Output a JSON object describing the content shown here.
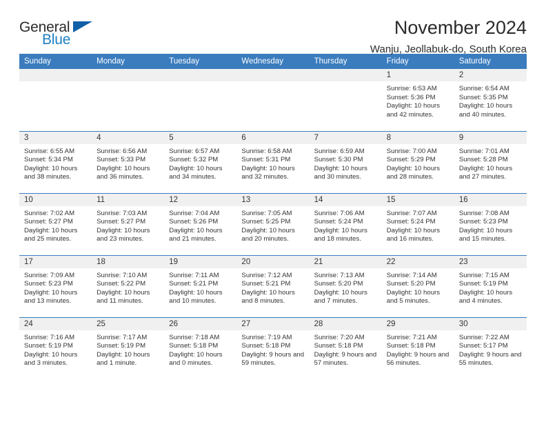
{
  "brand": {
    "name_part1": "General",
    "name_part2": "Blue",
    "flag_color": "#1060a8",
    "blue_color": "#1d7fc3"
  },
  "header": {
    "title": "November 2024",
    "subtitle": "Wanju, Jeollabuk-do, South Korea",
    "header_bar_color": "#3a7cbe"
  },
  "weekday_headers": [
    "Sunday",
    "Monday",
    "Tuesday",
    "Wednesday",
    "Thursday",
    "Friday",
    "Saturday"
  ],
  "labels": {
    "sunrise": "Sunrise:",
    "sunset": "Sunset:",
    "daylight": "Daylight:"
  },
  "weeks": [
    [
      {
        "day": "",
        "sunrise": "",
        "sunset": "",
        "daylight": "",
        "empty": true
      },
      {
        "day": "",
        "sunrise": "",
        "sunset": "",
        "daylight": "",
        "empty": true
      },
      {
        "day": "",
        "sunrise": "",
        "sunset": "",
        "daylight": "",
        "empty": true
      },
      {
        "day": "",
        "sunrise": "",
        "sunset": "",
        "daylight": "",
        "empty": true
      },
      {
        "day": "",
        "sunrise": "",
        "sunset": "",
        "daylight": "",
        "empty": true
      },
      {
        "day": "1",
        "sunrise": "Sunrise: 6:53 AM",
        "sunset": "Sunset: 5:36 PM",
        "daylight": "Daylight: 10 hours and 42 minutes."
      },
      {
        "day": "2",
        "sunrise": "Sunrise: 6:54 AM",
        "sunset": "Sunset: 5:35 PM",
        "daylight": "Daylight: 10 hours and 40 minutes."
      }
    ],
    [
      {
        "day": "3",
        "sunrise": "Sunrise: 6:55 AM",
        "sunset": "Sunset: 5:34 PM",
        "daylight": "Daylight: 10 hours and 38 minutes."
      },
      {
        "day": "4",
        "sunrise": "Sunrise: 6:56 AM",
        "sunset": "Sunset: 5:33 PM",
        "daylight": "Daylight: 10 hours and 36 minutes."
      },
      {
        "day": "5",
        "sunrise": "Sunrise: 6:57 AM",
        "sunset": "Sunset: 5:32 PM",
        "daylight": "Daylight: 10 hours and 34 minutes."
      },
      {
        "day": "6",
        "sunrise": "Sunrise: 6:58 AM",
        "sunset": "Sunset: 5:31 PM",
        "daylight": "Daylight: 10 hours and 32 minutes."
      },
      {
        "day": "7",
        "sunrise": "Sunrise: 6:59 AM",
        "sunset": "Sunset: 5:30 PM",
        "daylight": "Daylight: 10 hours and 30 minutes."
      },
      {
        "day": "8",
        "sunrise": "Sunrise: 7:00 AM",
        "sunset": "Sunset: 5:29 PM",
        "daylight": "Daylight: 10 hours and 28 minutes."
      },
      {
        "day": "9",
        "sunrise": "Sunrise: 7:01 AM",
        "sunset": "Sunset: 5:28 PM",
        "daylight": "Daylight: 10 hours and 27 minutes."
      }
    ],
    [
      {
        "day": "10",
        "sunrise": "Sunrise: 7:02 AM",
        "sunset": "Sunset: 5:27 PM",
        "daylight": "Daylight: 10 hours and 25 minutes."
      },
      {
        "day": "11",
        "sunrise": "Sunrise: 7:03 AM",
        "sunset": "Sunset: 5:27 PM",
        "daylight": "Daylight: 10 hours and 23 minutes."
      },
      {
        "day": "12",
        "sunrise": "Sunrise: 7:04 AM",
        "sunset": "Sunset: 5:26 PM",
        "daylight": "Daylight: 10 hours and 21 minutes."
      },
      {
        "day": "13",
        "sunrise": "Sunrise: 7:05 AM",
        "sunset": "Sunset: 5:25 PM",
        "daylight": "Daylight: 10 hours and 20 minutes."
      },
      {
        "day": "14",
        "sunrise": "Sunrise: 7:06 AM",
        "sunset": "Sunset: 5:24 PM",
        "daylight": "Daylight: 10 hours and 18 minutes."
      },
      {
        "day": "15",
        "sunrise": "Sunrise: 7:07 AM",
        "sunset": "Sunset: 5:24 PM",
        "daylight": "Daylight: 10 hours and 16 minutes."
      },
      {
        "day": "16",
        "sunrise": "Sunrise: 7:08 AM",
        "sunset": "Sunset: 5:23 PM",
        "daylight": "Daylight: 10 hours and 15 minutes."
      }
    ],
    [
      {
        "day": "17",
        "sunrise": "Sunrise: 7:09 AM",
        "sunset": "Sunset: 5:23 PM",
        "daylight": "Daylight: 10 hours and 13 minutes."
      },
      {
        "day": "18",
        "sunrise": "Sunrise: 7:10 AM",
        "sunset": "Sunset: 5:22 PM",
        "daylight": "Daylight: 10 hours and 11 minutes."
      },
      {
        "day": "19",
        "sunrise": "Sunrise: 7:11 AM",
        "sunset": "Sunset: 5:21 PM",
        "daylight": "Daylight: 10 hours and 10 minutes."
      },
      {
        "day": "20",
        "sunrise": "Sunrise: 7:12 AM",
        "sunset": "Sunset: 5:21 PM",
        "daylight": "Daylight: 10 hours and 8 minutes."
      },
      {
        "day": "21",
        "sunrise": "Sunrise: 7:13 AM",
        "sunset": "Sunset: 5:20 PM",
        "daylight": "Daylight: 10 hours and 7 minutes."
      },
      {
        "day": "22",
        "sunrise": "Sunrise: 7:14 AM",
        "sunset": "Sunset: 5:20 PM",
        "daylight": "Daylight: 10 hours and 5 minutes."
      },
      {
        "day": "23",
        "sunrise": "Sunrise: 7:15 AM",
        "sunset": "Sunset: 5:19 PM",
        "daylight": "Daylight: 10 hours and 4 minutes."
      }
    ],
    [
      {
        "day": "24",
        "sunrise": "Sunrise: 7:16 AM",
        "sunset": "Sunset: 5:19 PM",
        "daylight": "Daylight: 10 hours and 3 minutes."
      },
      {
        "day": "25",
        "sunrise": "Sunrise: 7:17 AM",
        "sunset": "Sunset: 5:19 PM",
        "daylight": "Daylight: 10 hours and 1 minute."
      },
      {
        "day": "26",
        "sunrise": "Sunrise: 7:18 AM",
        "sunset": "Sunset: 5:18 PM",
        "daylight": "Daylight: 10 hours and 0 minutes."
      },
      {
        "day": "27",
        "sunrise": "Sunrise: 7:19 AM",
        "sunset": "Sunset: 5:18 PM",
        "daylight": "Daylight: 9 hours and 59 minutes."
      },
      {
        "day": "28",
        "sunrise": "Sunrise: 7:20 AM",
        "sunset": "Sunset: 5:18 PM",
        "daylight": "Daylight: 9 hours and 57 minutes."
      },
      {
        "day": "29",
        "sunrise": "Sunrise: 7:21 AM",
        "sunset": "Sunset: 5:18 PM",
        "daylight": "Daylight: 9 hours and 56 minutes."
      },
      {
        "day": "30",
        "sunrise": "Sunrise: 7:22 AM",
        "sunset": "Sunset: 5:17 PM",
        "daylight": "Daylight: 9 hours and 55 minutes."
      }
    ]
  ]
}
